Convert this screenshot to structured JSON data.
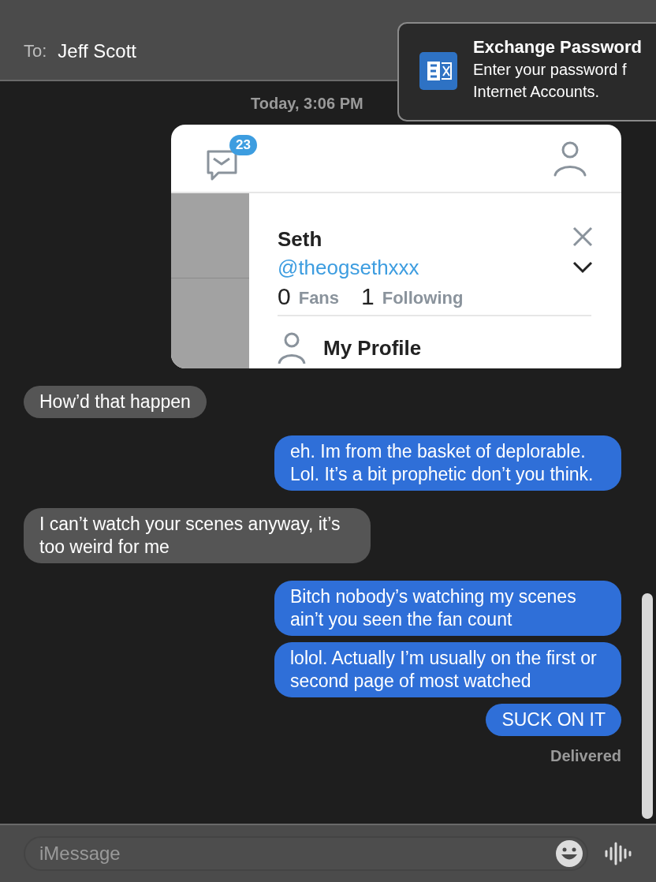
{
  "header": {
    "to_label": "To:",
    "recipient": "Jeff Scott"
  },
  "notification": {
    "title": "Exchange Password",
    "lines": [
      "Enter your password f",
      "Internet Accounts."
    ]
  },
  "timestamp": "Today, 3:06 PM",
  "messages": [
    {
      "kind": "image",
      "outgoing": true,
      "screenshot": {
        "badge": "23",
        "name": "Seth",
        "handle": "@theogsethxxx",
        "stats": [
          {
            "count": "0",
            "label": "Fans"
          },
          {
            "count": "1",
            "label": "Following"
          }
        ],
        "menu_item": "My Profile"
      }
    },
    {
      "kind": "text",
      "outgoing": false,
      "text": "How’d that happen"
    },
    {
      "kind": "text",
      "outgoing": true,
      "text": "eh. Im from the basket of deplorable. Lol. It’s a bit prophetic don’t you think."
    },
    {
      "kind": "text",
      "outgoing": false,
      "text": "I can’t watch your scenes anyway, it’s too weird for me"
    },
    {
      "kind": "text",
      "outgoing": true,
      "text": "Bitch nobody’s watching my scenes ain’t you seen the fan count"
    },
    {
      "kind": "text",
      "outgoing": true,
      "text": "lolol. Actually I’m usually on the first or second page of most watched"
    },
    {
      "kind": "text",
      "outgoing": true,
      "text": "SUCK ON IT"
    }
  ],
  "status": "Delivered",
  "input": {
    "placeholder": "iMessage"
  }
}
